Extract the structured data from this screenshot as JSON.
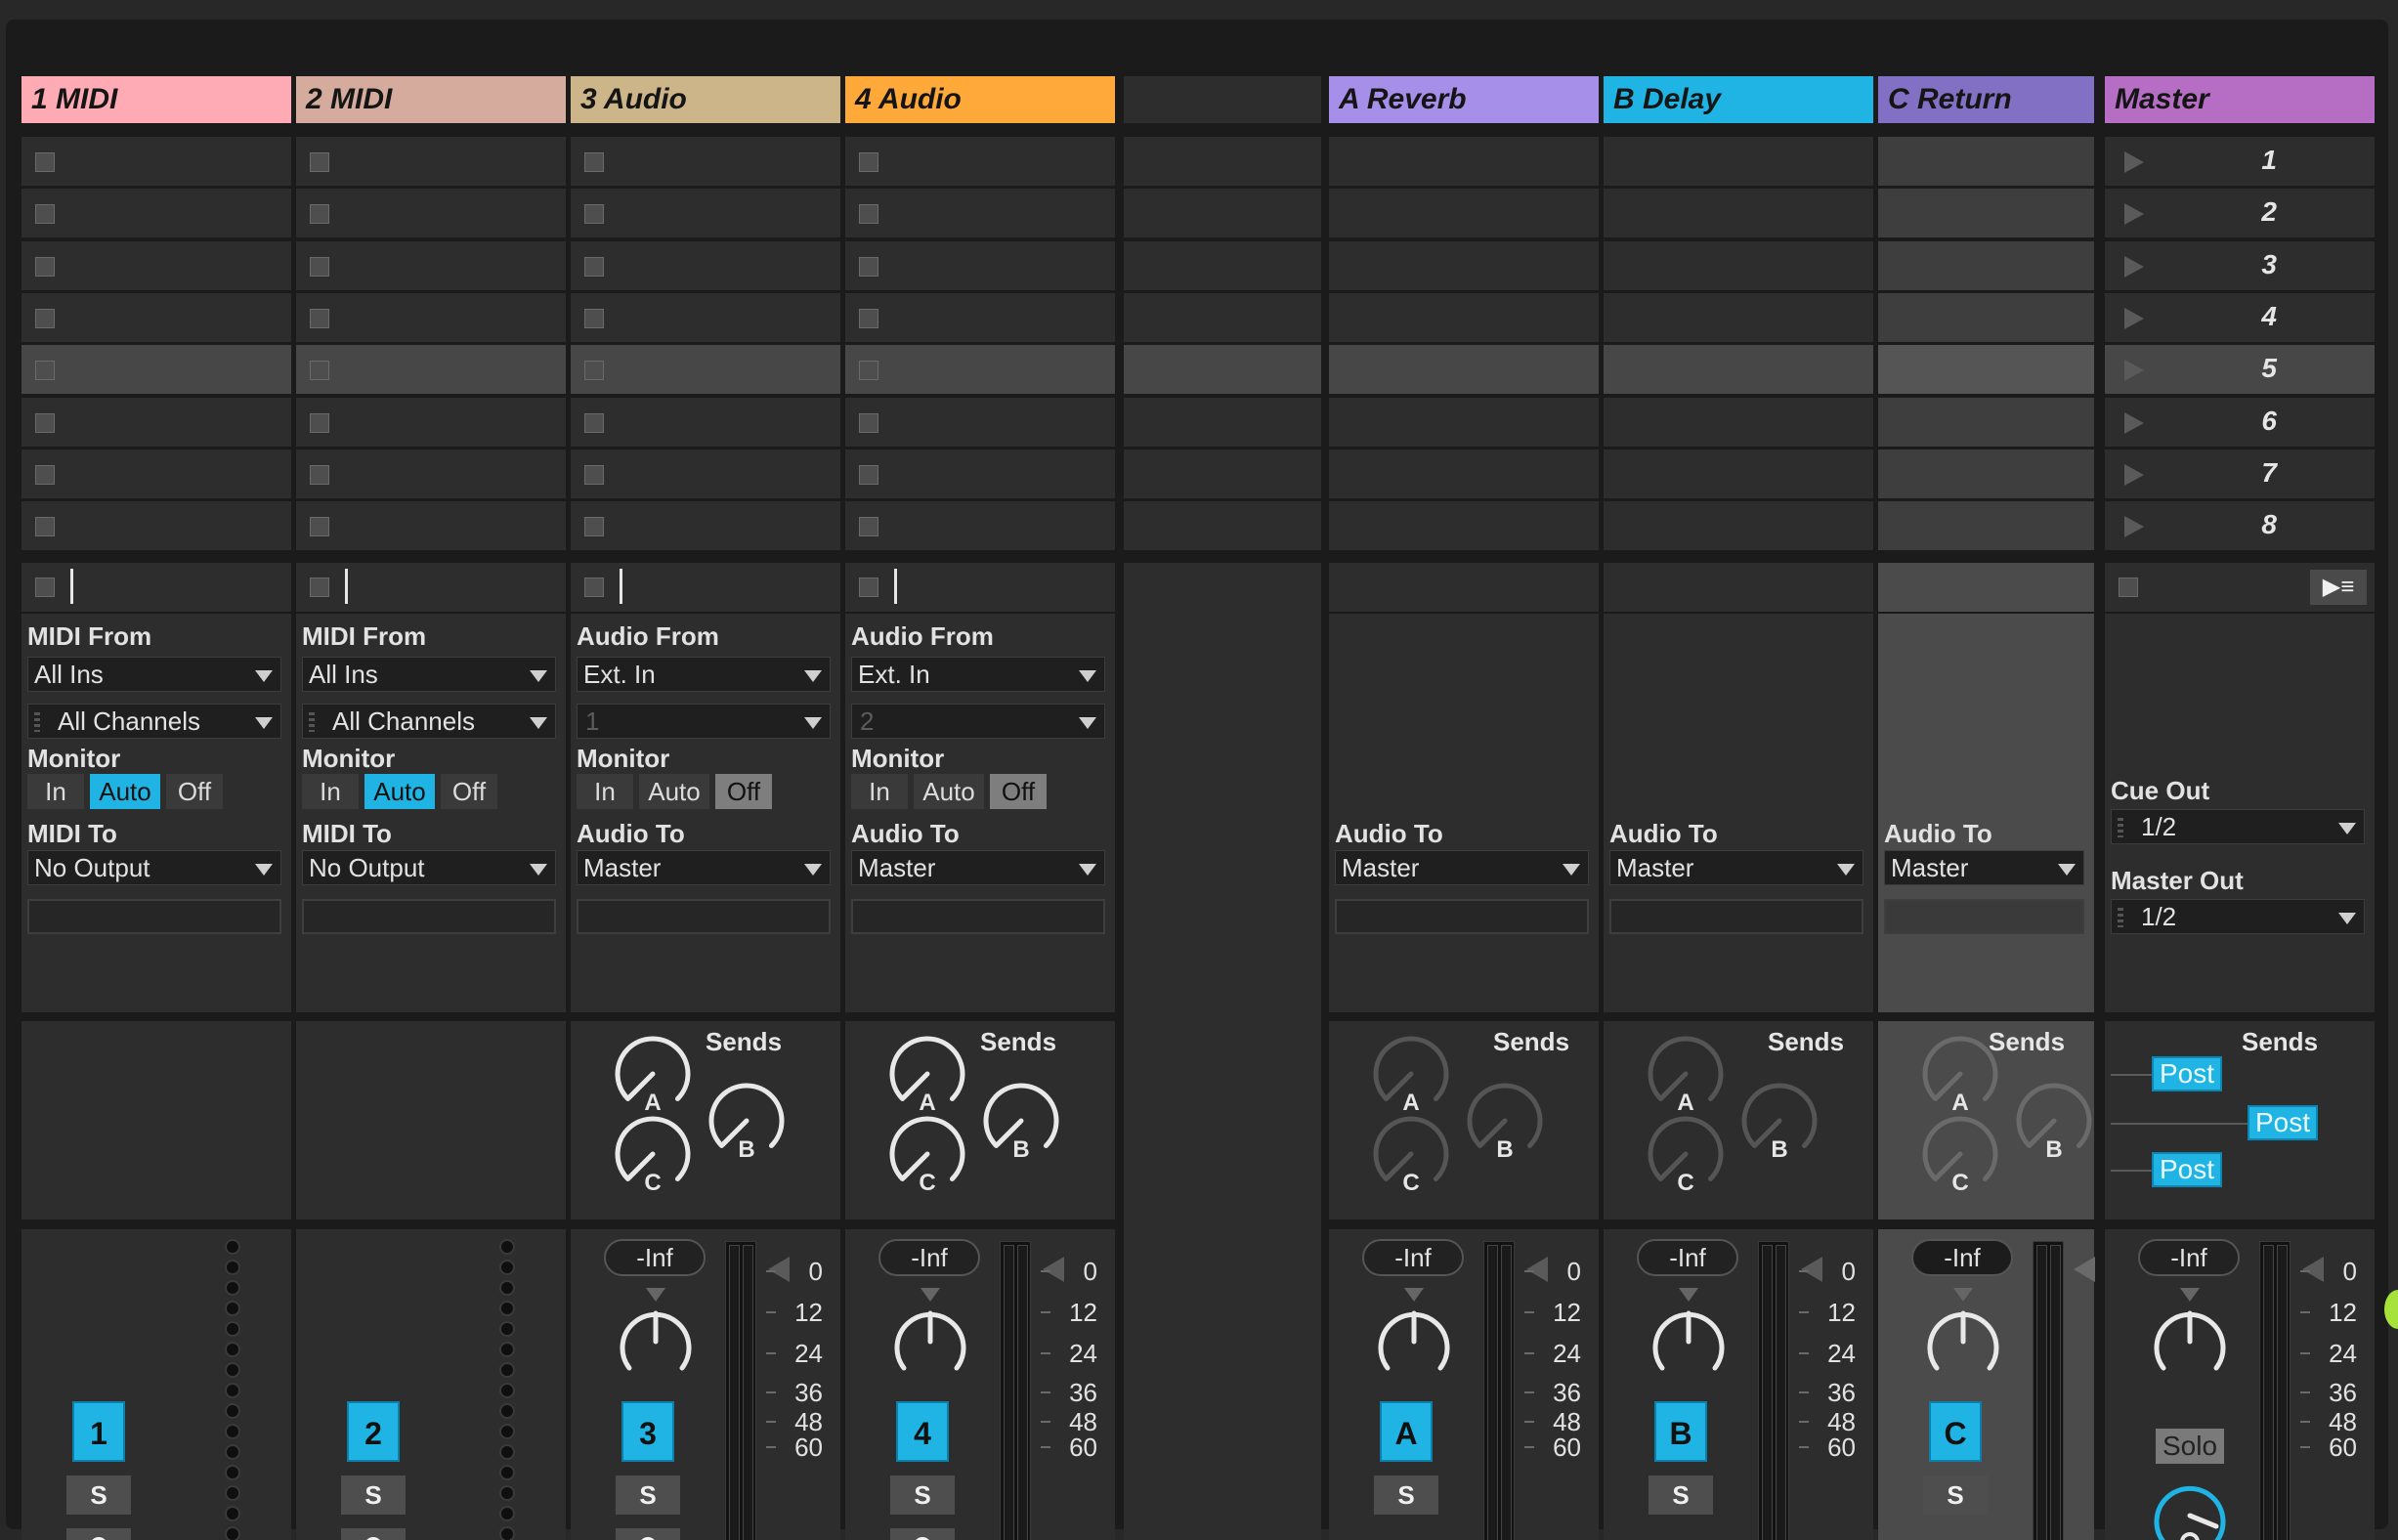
{
  "tracks": [
    {
      "title": "1 MIDI",
      "color": "#ffabb5",
      "type": "midi",
      "input_label": "MIDI From",
      "input_value": "All Ins",
      "channel_value": "All Channels",
      "monitor_label": "Monitor",
      "monitor_options": [
        "In",
        "Auto",
        "Off"
      ],
      "monitor_selected": "Auto",
      "output_label": "MIDI To",
      "output_value": "No Output",
      "track_number": "1",
      "solo": "S"
    },
    {
      "title": "2 MIDI",
      "color": "#d5ab9e",
      "type": "midi",
      "input_label": "MIDI From",
      "input_value": "All Ins",
      "channel_value": "All Channels",
      "monitor_label": "Monitor",
      "monitor_options": [
        "In",
        "Auto",
        "Off"
      ],
      "monitor_selected": "Auto",
      "output_label": "MIDI To",
      "output_value": "No Output",
      "track_number": "2",
      "solo": "S"
    },
    {
      "title": "3 Audio",
      "color": "#cdb58a",
      "type": "audio",
      "input_label": "Audio From",
      "input_value": "Ext. In",
      "channel_value": "1",
      "monitor_label": "Monitor",
      "monitor_options": [
        "In",
        "Auto",
        "Off"
      ],
      "monitor_selected": "Off",
      "output_label": "Audio To",
      "output_value": "Master",
      "track_number": "3",
      "solo": "S",
      "sends_label": "Sends",
      "send_labels": [
        "A",
        "B",
        "C"
      ],
      "volume": "-Inf"
    },
    {
      "title": "4 Audio",
      "color": "#ffa93b",
      "type": "audio",
      "input_label": "Audio From",
      "input_value": "Ext. In",
      "channel_value": "2",
      "monitor_label": "Monitor",
      "monitor_options": [
        "In",
        "Auto",
        "Off"
      ],
      "monitor_selected": "Off",
      "output_label": "Audio To",
      "output_value": "Master",
      "track_number": "4",
      "solo": "S",
      "sends_label": "Sends",
      "send_labels": [
        "A",
        "B",
        "C"
      ],
      "volume": "-Inf"
    }
  ],
  "returns": [
    {
      "title": "A Reverb",
      "color": "#a58fe9",
      "output_label": "Audio To",
      "output_value": "Master",
      "sends_label": "Sends",
      "send_labels": [
        "A",
        "B",
        "C"
      ],
      "volume": "-Inf",
      "track_letter": "A",
      "solo": "S"
    },
    {
      "title": "B Delay",
      "color": "#1fb4e4",
      "output_label": "Audio To",
      "output_value": "Master",
      "sends_label": "Sends",
      "send_labels": [
        "A",
        "B",
        "C"
      ],
      "volume": "-Inf",
      "track_letter": "B",
      "solo": "S"
    },
    {
      "title": "C Return",
      "color": "#8170c4",
      "output_label": "Audio To",
      "output_value": "Master",
      "sends_label": "Sends",
      "send_labels": [
        "A",
        "B",
        "C"
      ],
      "volume": "-Inf",
      "track_letter": "C",
      "solo": "S"
    }
  ],
  "master": {
    "title": "Master",
    "color": "#b66ec4",
    "scenes": [
      "1",
      "2",
      "3",
      "4",
      "5",
      "6",
      "7",
      "8"
    ],
    "stop_all_icon": "▶≡",
    "cue_out_label": "Cue Out",
    "cue_out_value": "1/2",
    "master_out_label": "Master Out",
    "master_out_value": "1/2",
    "sends_label": "Sends",
    "post_labels": [
      "Post",
      "Post",
      "Post"
    ],
    "volume": "-Inf",
    "solo_label": "Solo"
  },
  "meter_ticks": [
    "0",
    "12",
    "24",
    "36",
    "48",
    "60"
  ],
  "selected_scene_index": 4,
  "icons": {
    "clip_stop": "stop-square-icon",
    "scene_launch": "play-triangle-icon",
    "record_arm": "record-dot-icon",
    "monitor_clock": "clock-icon",
    "cue_knob": "headphone-knob-icon"
  },
  "colors": {
    "accent": "#1fb4e4",
    "background": "#1b1b1b",
    "slot": "#2d2d2d",
    "selected_row": "#474747"
  }
}
